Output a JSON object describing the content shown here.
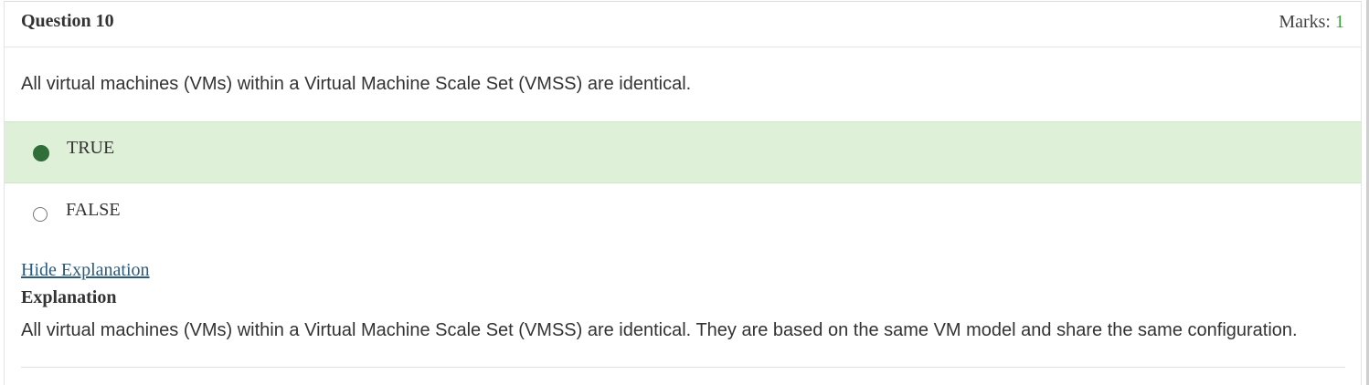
{
  "header": {
    "question_title": "Question 10",
    "marks_label": "Marks: ",
    "marks_value": "1"
  },
  "question": {
    "text": "All virtual machines (VMs) within a Virtual Machine Scale Set (VMSS) are identical."
  },
  "options": [
    {
      "label": "TRUE",
      "selected": true,
      "correct": true
    },
    {
      "label": "FALSE",
      "selected": false,
      "correct": false
    }
  ],
  "explanation": {
    "toggle_label": "Hide Explanation",
    "heading": "Explanation",
    "text": "All virtual machines (VMs) within a Virtual Machine Scale Set (VMSS) are identical. They are based on the same VM model and share the same configuration."
  },
  "colors": {
    "correct_background": "#dff0d8",
    "selected_radio": "#2f6e38",
    "marks_value": "#3c9a3c",
    "link": "#2a5a7c"
  }
}
